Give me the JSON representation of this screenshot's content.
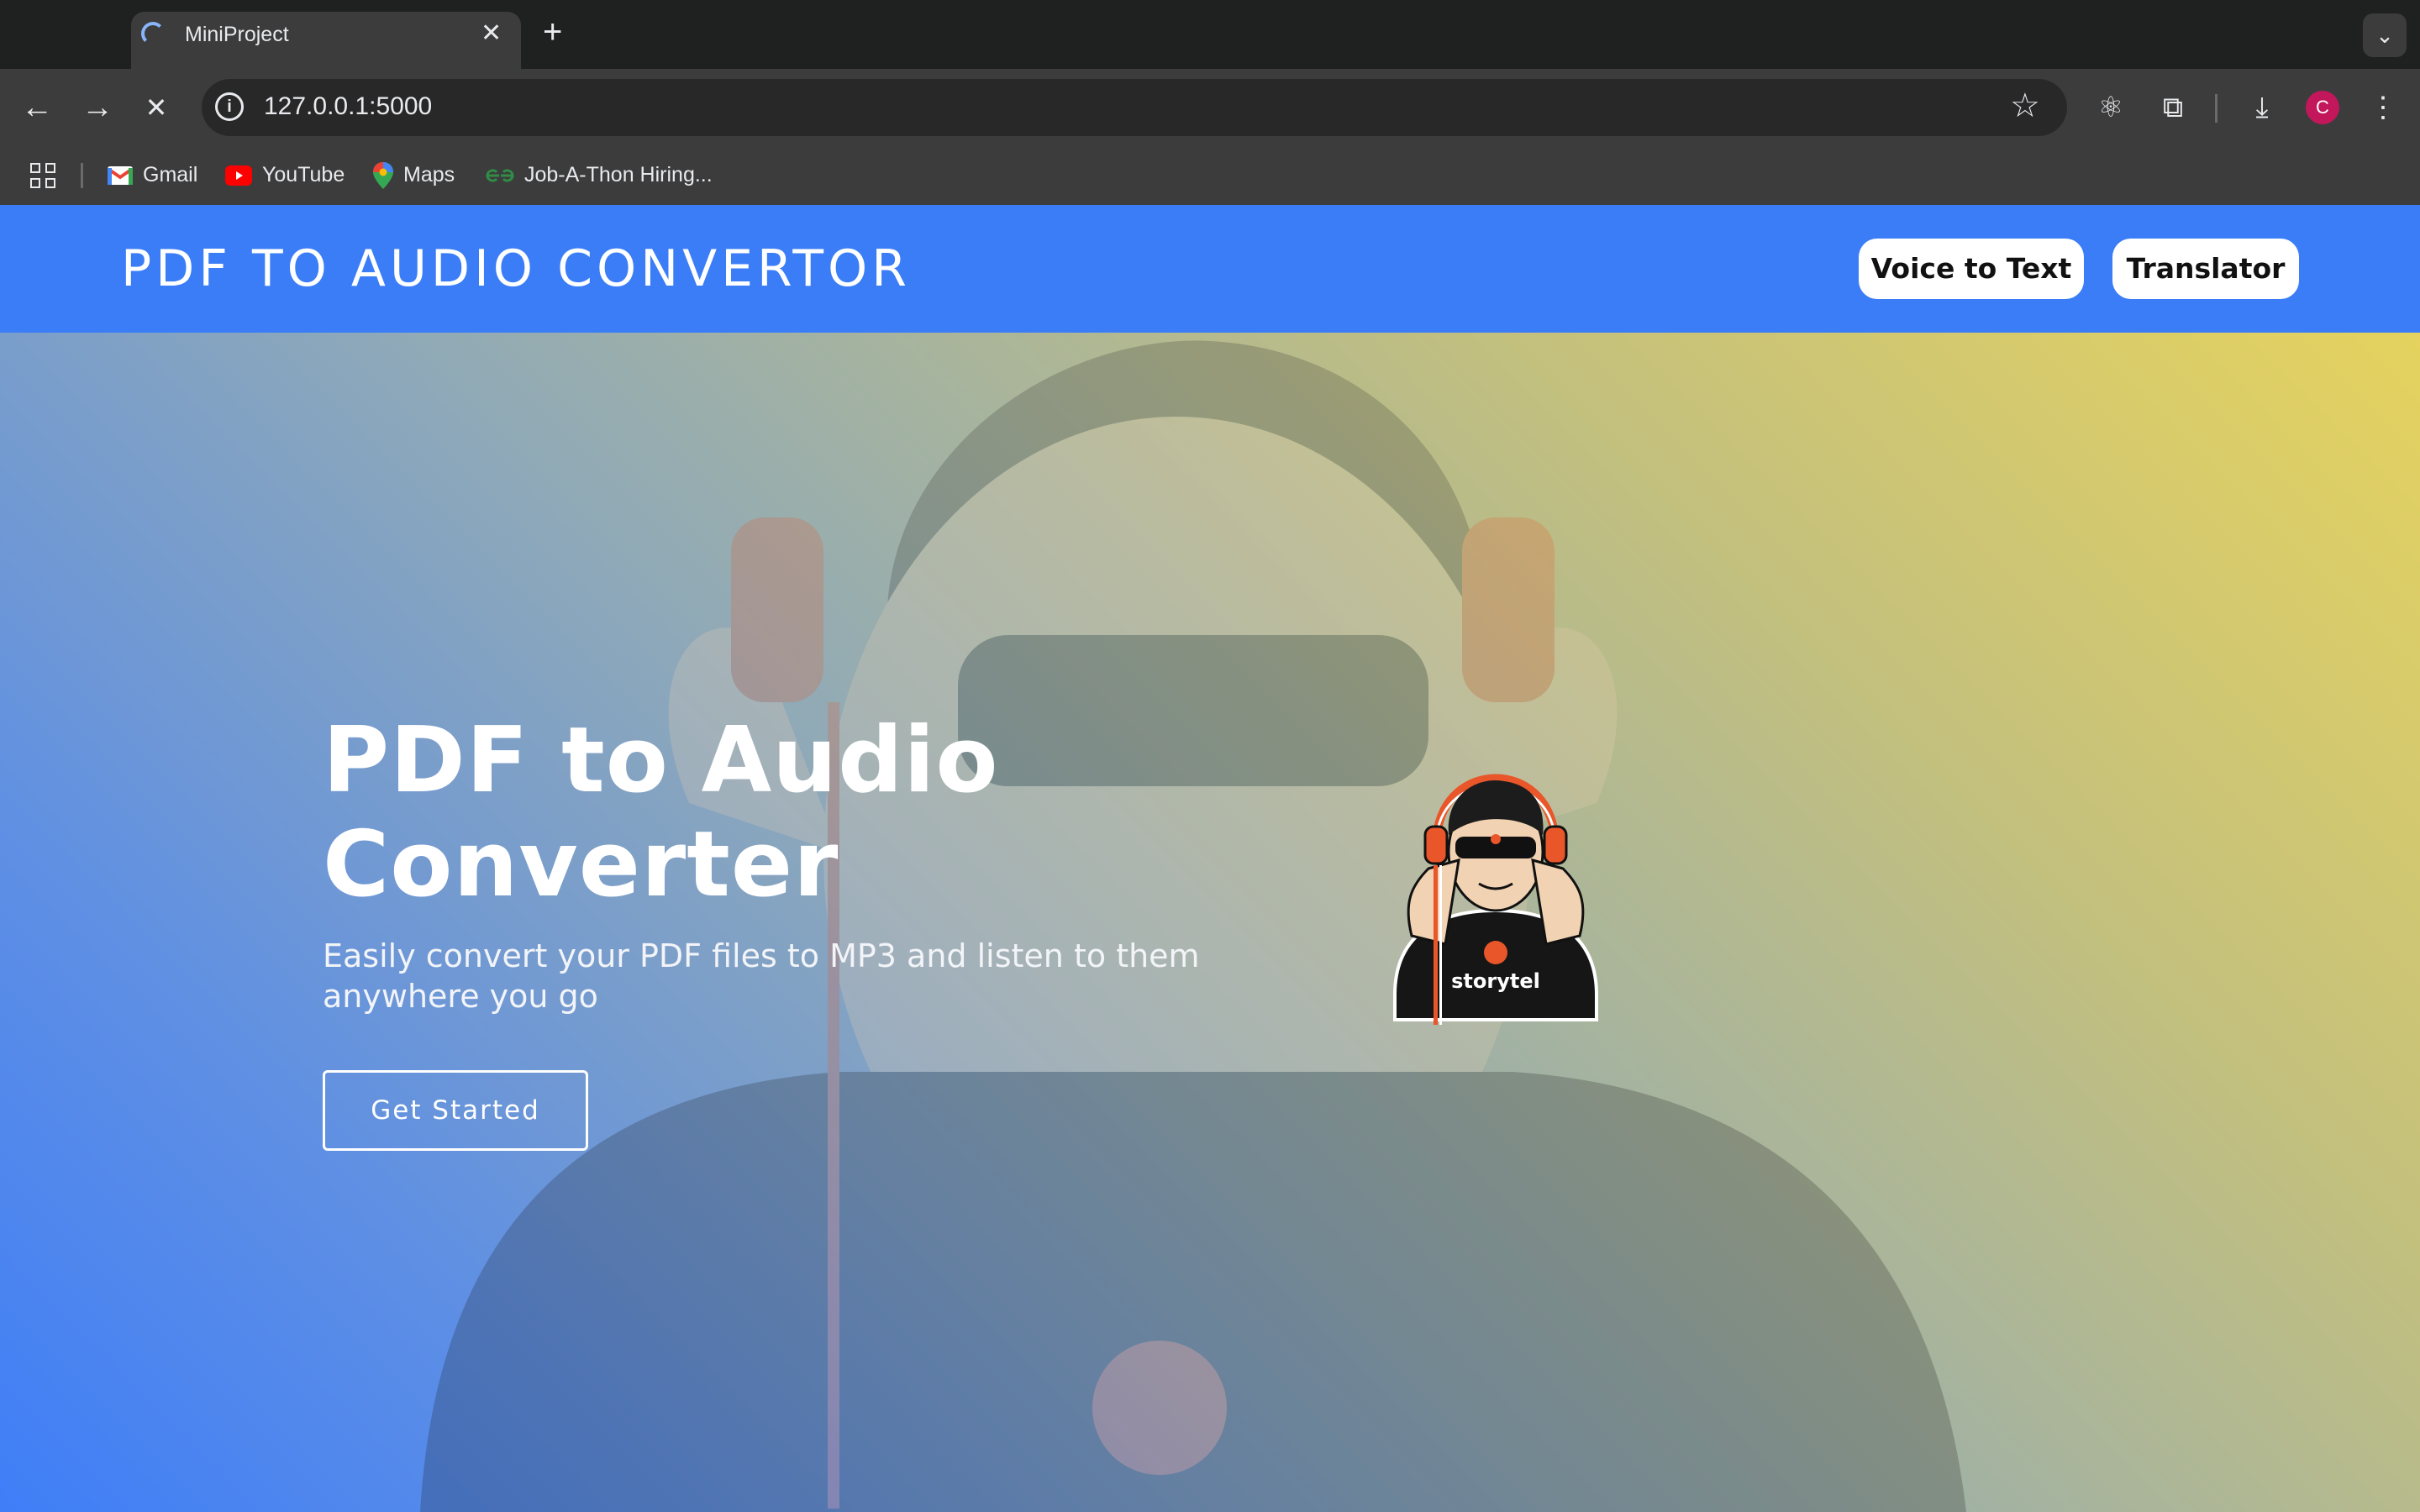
{
  "browser": {
    "tab": {
      "title": "MiniProject",
      "close_glyph": "✕"
    },
    "new_tab_glyph": "+",
    "tab_menu_glyph": "⌄",
    "nav": {
      "back_glyph": "←",
      "forward_glyph": "→",
      "stop_glyph": "✕"
    },
    "address": {
      "info_glyph": "i",
      "url": "127.0.0.1:5000"
    },
    "star_glyph": "☆",
    "toolbar_icons": {
      "react_glyph": "⚛",
      "extensions_glyph": "⧉",
      "download_glyph": "⤓",
      "menu_glyph": "⋮"
    },
    "profile_initial": "C",
    "bookmarks": [
      {
        "label": "Gmail",
        "icon": "gmail-icon"
      },
      {
        "label": "YouTube",
        "icon": "youtube-icon"
      },
      {
        "label": "Maps",
        "icon": "maps-icon"
      },
      {
        "label": "Job-A-Thon Hiring...",
        "icon": "gfg-icon"
      }
    ]
  },
  "page": {
    "site_title": "PDF TO AUDIO CONVERTOR",
    "nav_buttons": [
      "Voice to Text",
      "Translator"
    ],
    "hero": {
      "title": "PDF to Audio Converter",
      "subtitle": "Easily convert your PDF files to MP3 and listen to them anywhere you go",
      "cta_label": "Get Started"
    },
    "mascot_brand": "storytel"
  },
  "colors": {
    "header_blue": "#3b7df7",
    "gradient_yellow": "#ead55a",
    "gradient_blue": "#3f7ef8",
    "headphone_orange": "#e8562a"
  }
}
